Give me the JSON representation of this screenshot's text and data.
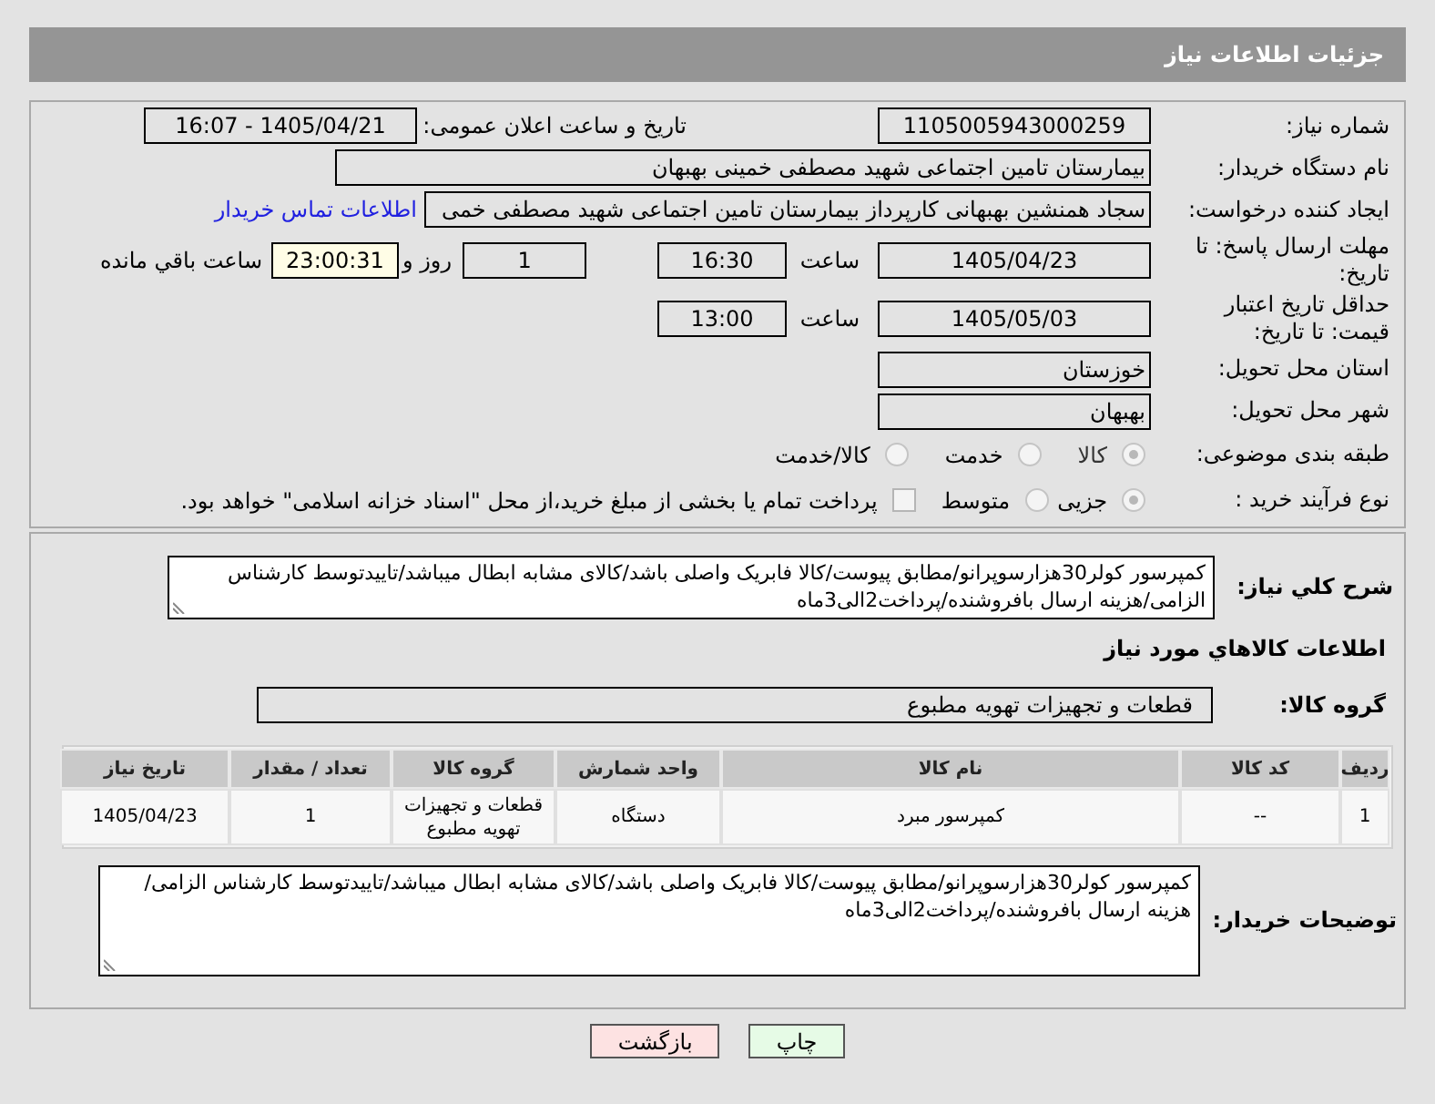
{
  "header": {
    "title": "جزئیات اطلاعات نیاز"
  },
  "need_number": {
    "label": "شماره نیاز:",
    "value": "1105005943000259"
  },
  "announce": {
    "label": "تاریخ و ساعت اعلان عمومی:",
    "value": "1405/04/21 - 16:07"
  },
  "buyer": {
    "label": "نام دستگاه خریدار:",
    "value": "بیمارستان تامین اجتماعی شهید مصطفی خمینی بهبهان"
  },
  "requester": {
    "label": "ایجاد کننده درخواست:",
    "value": "سجاد همنشین بهبهانی کارپرداز بیمارستان تامین اجتماعی شهید مصطفی خمی",
    "link": "اطلاعات تماس خریدار"
  },
  "deadline": {
    "label": "مهلت ارسال پاسخ: تا تاریخ:",
    "date": "1405/04/23",
    "time_label": "ساعت",
    "time": "16:30",
    "days": "1",
    "days_label": "روز و",
    "remaining": "23:00:31",
    "remaining_label": "ساعت باقي مانده"
  },
  "validity": {
    "label": "حداقل تاریخ اعتبار قیمت: تا تاریخ:",
    "date": "1405/05/03",
    "time_label": "ساعت",
    "time": "13:00"
  },
  "province": {
    "label": "استان محل تحویل:",
    "value": "خوزستان"
  },
  "city": {
    "label": "شهر محل تحویل:",
    "value": "بهبهان"
  },
  "category": {
    "label": "طبقه بندی موضوعی:",
    "options": [
      {
        "label": "کالا",
        "selected": true
      },
      {
        "label": "خدمت",
        "selected": false
      },
      {
        "label": "کالا/خدمت",
        "selected": false
      }
    ]
  },
  "process": {
    "label": "نوع فرآیند خرید :",
    "options": [
      {
        "label": "جزیی",
        "selected": true
      },
      {
        "label": "متوسط",
        "selected": false
      }
    ],
    "payment": {
      "label": "پرداخت تمام یا بخشی از مبلغ خرید،از محل \"اسناد خزانه اسلامی\" خواهد بود.",
      "checked": false
    }
  },
  "description": {
    "label": "شرح کلي نياز:",
    "value": "کمپرسور کولر30هزارسوپرانو/مطابق پیوست/کالا فابریک واصلی باشد/کالای مشابه ابطال میباشد/تاییدتوسط کارشناس الزامی/هزینه ارسال بافروشنده/پرداخت2الی3ماه"
  },
  "goods_heading": "اطلاعات كالاهاي مورد نياز",
  "goods_group": {
    "label": "گروه کالا:",
    "value": "قطعات و تجهیزات تهویه مطبوع"
  },
  "table": {
    "columns": [
      "ردیف",
      "کد کالا",
      "نام کالا",
      "واحد شمارش",
      "گروه کالا",
      "تعداد / مقدار",
      "تاریخ نیاز"
    ],
    "rows": [
      [
        "1",
        "--",
        "کمپرسور مبرد",
        "دستگاه",
        "قطعات و تجهیزات تهویه مطبوع",
        "1",
        "1405/04/23"
      ]
    ]
  },
  "buyer_notes": {
    "label": "توضیحات خریدار:",
    "value": "کمپرسور کولر30هزارسوپرانو/مطابق پیوست/کالا فابریک واصلی باشد/کالای مشابه ابطال میباشد/تاییدتوسط کارشناس الزامی/هزینه ارسال بافروشنده/پرداخت2الی3ماه"
  },
  "buttons": [
    {
      "label": "چاپ",
      "kind": "print"
    },
    {
      "label": "بازگشت",
      "kind": "back"
    }
  ]
}
